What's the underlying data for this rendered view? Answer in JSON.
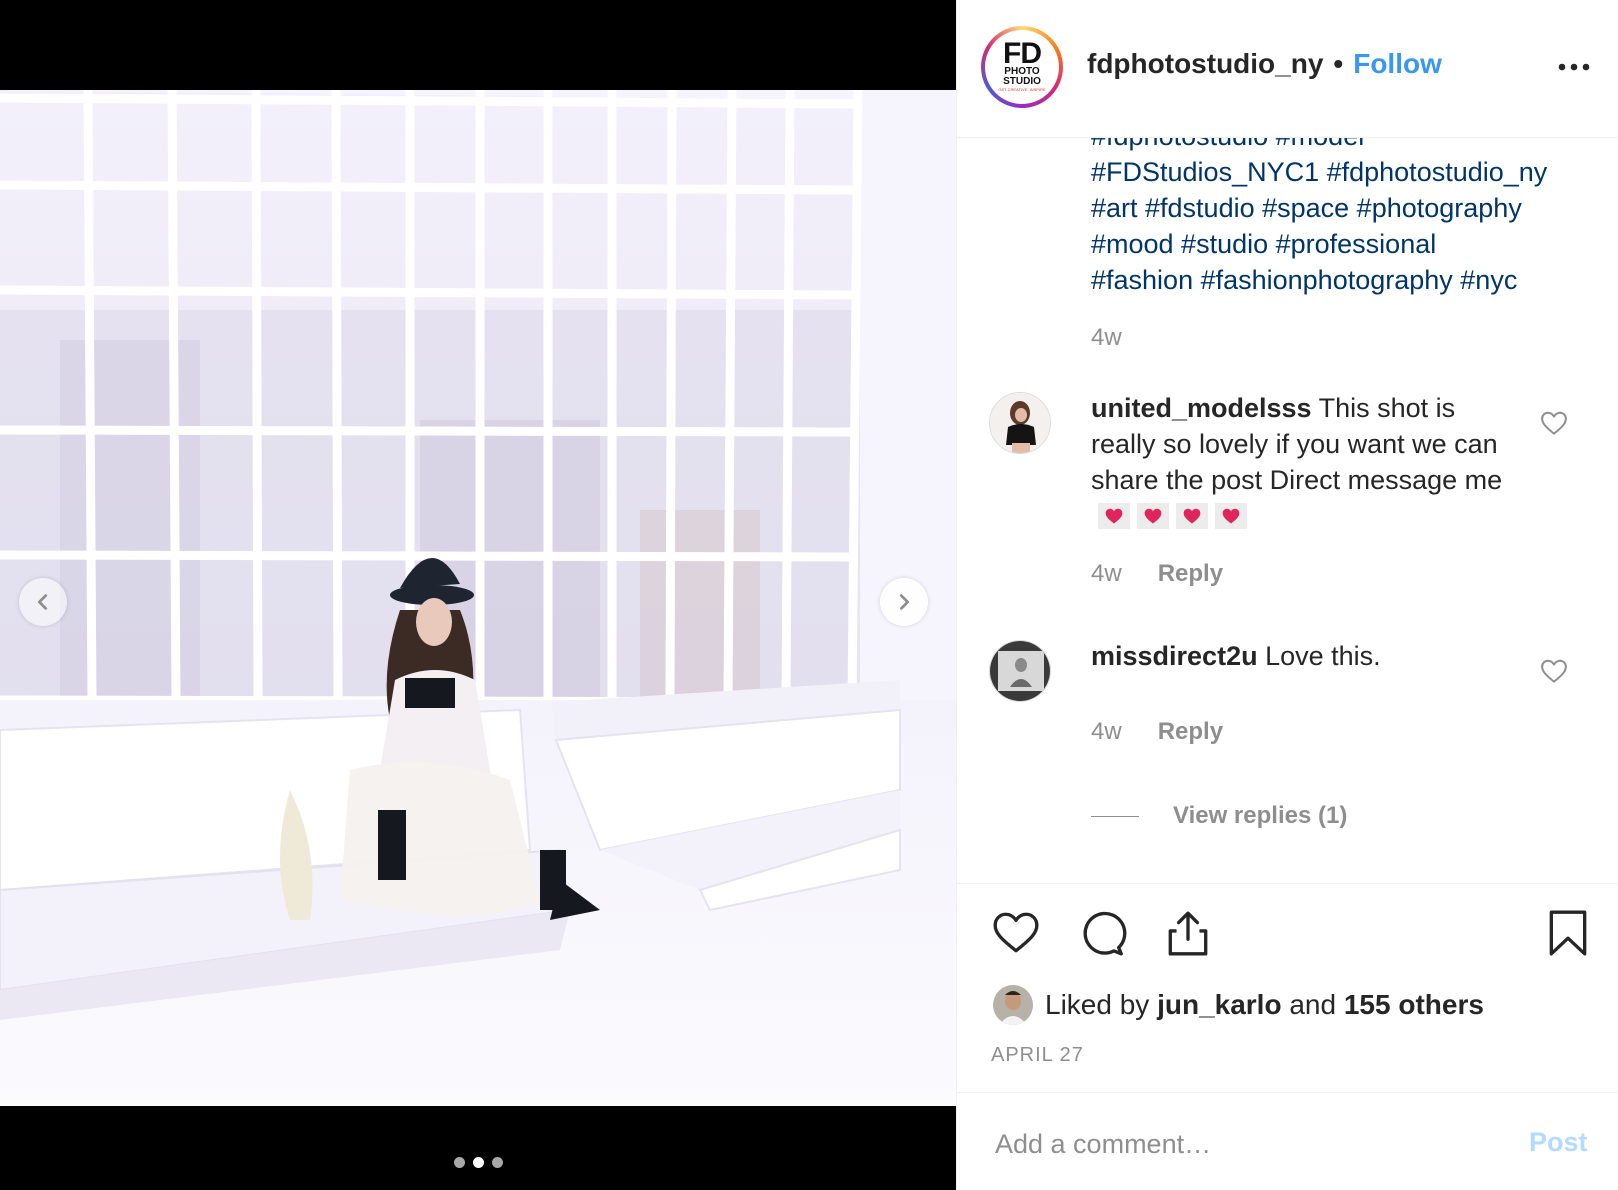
{
  "post": {
    "username": "fdphotostudio_ny",
    "separator": "•",
    "follow_label": "Follow",
    "avatar_logo": {
      "big": "FD",
      "line1": "PHOTO",
      "line2": "STUDIO",
      "tagline": "GET CREATIVE. INSPIRE"
    },
    "more_icon": "more-horizontal-icon"
  },
  "media": {
    "slide_count": 3,
    "active_slide": 2,
    "prev_icon": "chevron-left-icon",
    "next_icon": "chevron-right-icon"
  },
  "caption": {
    "lines": [
      "#fdphotostudio #model",
      "#FDStudios_NYC1 #fdphotostudio_ny",
      "#art #fdstudio #space #photography",
      "#mood #studio #professional",
      "#fashion #fashionphotography #nyc"
    ],
    "age": "4w"
  },
  "comments": [
    {
      "user": "united_modelsss",
      "text": "This shot is really so lovely if you want we can share the post Direct message me",
      "emoji_count": 4,
      "emoji_icon": "red-heart-icon",
      "age": "4w",
      "reply_label": "Reply"
    },
    {
      "user": "missdirect2u",
      "text": "Love this.",
      "age": "4w",
      "reply_label": "Reply",
      "view_replies_label": "View replies (1)"
    }
  ],
  "actions": {
    "icons": [
      "heart-icon",
      "comment-icon",
      "share-icon",
      "bookmark-icon"
    ],
    "liked_prefix": "Liked by",
    "liked_user": "jun_karlo",
    "liked_and": "and",
    "liked_others": "155 others",
    "date": "APRIL 27"
  },
  "comment_box": {
    "placeholder": "Add a comment…",
    "post_label": "Post"
  },
  "colors": {
    "link_blue": "#3897f0",
    "hashtag_blue": "#003569",
    "muted_gray": "#8e8e8e",
    "post_disabled": "#b3dbff"
  }
}
